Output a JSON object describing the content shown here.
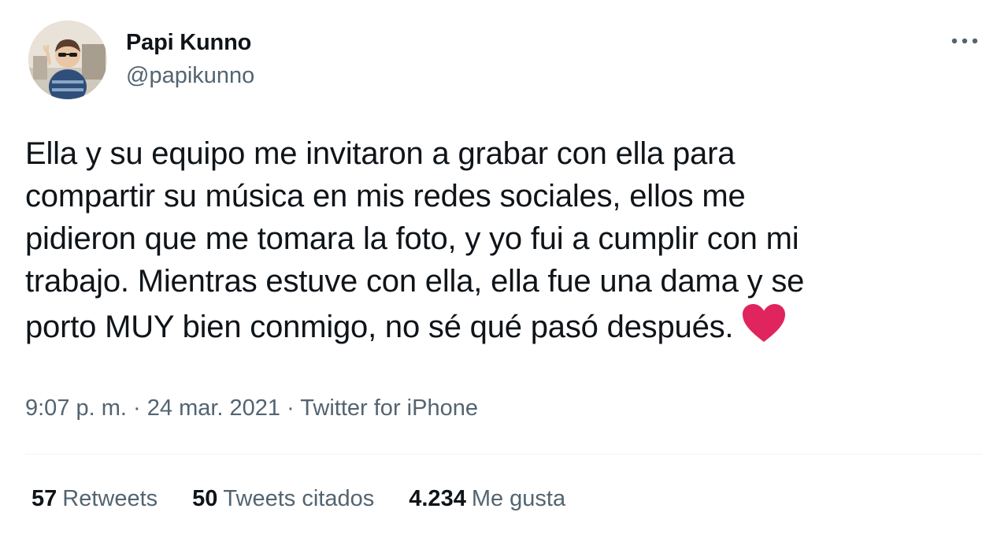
{
  "author": {
    "display_name": "Papi Kunno",
    "handle": "@papikunno"
  },
  "tweet": {
    "lines": [
      "Ella y su equipo me invitaron a grabar con ella para",
      "compartir su música en mis redes sociales, ellos me",
      "pidieron que me tomara la foto, y yo fui a cumplir con mi",
      "trabajo. Mientras estuve con ella, ella fue una dama y se",
      "porto MUY bien conmigo, no sé qué pasó después."
    ],
    "trailing_emoji": "red-heart-emoji"
  },
  "meta": {
    "time": "9:07 p. m.",
    "separator": " · ",
    "date": "24 mar. 2021",
    "source": "Twitter for iPhone"
  },
  "stats": {
    "retweets_count": "57",
    "retweets_label": "Retweets",
    "quotes_count": "50",
    "quotes_label": "Tweets citados",
    "likes_count": "4.234",
    "likes_label": "Me gusta"
  },
  "colors": {
    "text_primary": "#0f1419",
    "text_secondary": "#536471",
    "divider": "#eff3f4",
    "heart": "#e0245e"
  },
  "icons": {
    "more": "more-horizontal-icon",
    "heart": "red-heart-emoji"
  }
}
